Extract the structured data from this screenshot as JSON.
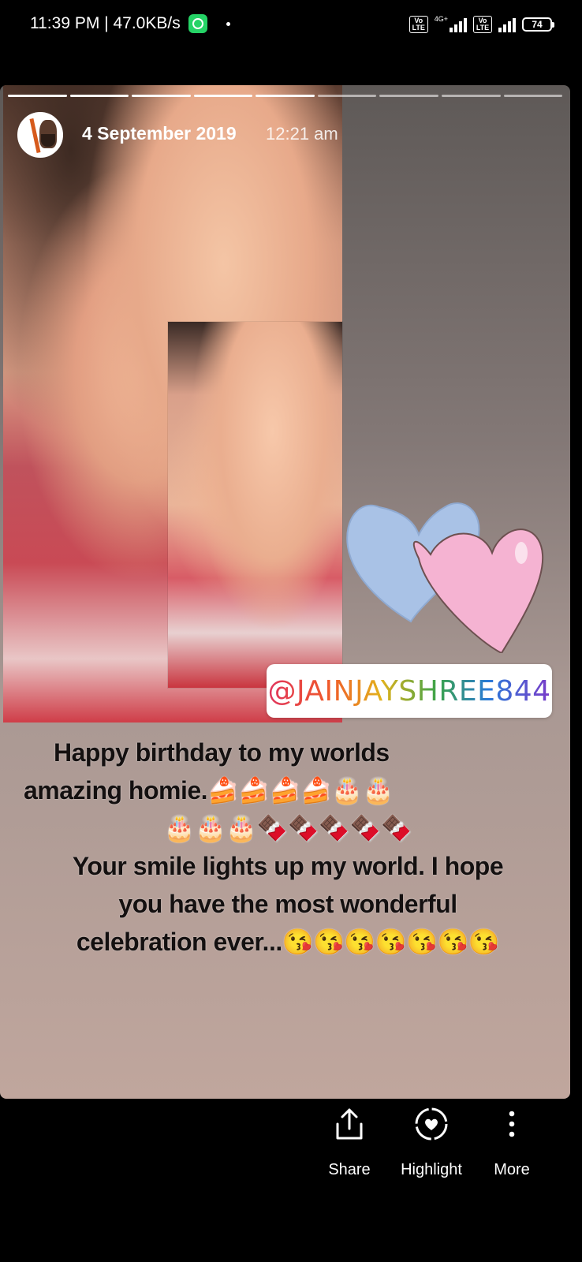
{
  "status_bar": {
    "time": "11:39 PM",
    "separator": "|",
    "net_speed": "47.0KB/s",
    "sim1_badge": "Vo LTE",
    "network_type": "4G+",
    "sim2_badge": "Vo LTE",
    "battery": "74"
  },
  "story": {
    "date": "4 September 2019",
    "time": "12:21 am",
    "progress_segments_total": 9,
    "progress_segments_done": 5,
    "mention": "@JAINJAYSHREE844",
    "caption_line1": "Happy birthday to my worlds",
    "caption_line2": "amazing homie.🍰🍰🍰🍰🎂🎂",
    "caption_line3": "🎂🎂🎂🍫🍫🍫🍫🍫",
    "caption_line4": "Your smile lights up my world. I hope",
    "caption_line5": "you have the most wonderful",
    "caption_line6": "celebration ever...😘😘😘😘😘😘😘"
  },
  "actions": {
    "share_label": "Share",
    "highlight_label": "Highlight",
    "more_label": "More"
  },
  "colors": {
    "heart_blue": "#a9c2e6",
    "heart_pink": "#f5b3d2",
    "background": "#000000"
  }
}
